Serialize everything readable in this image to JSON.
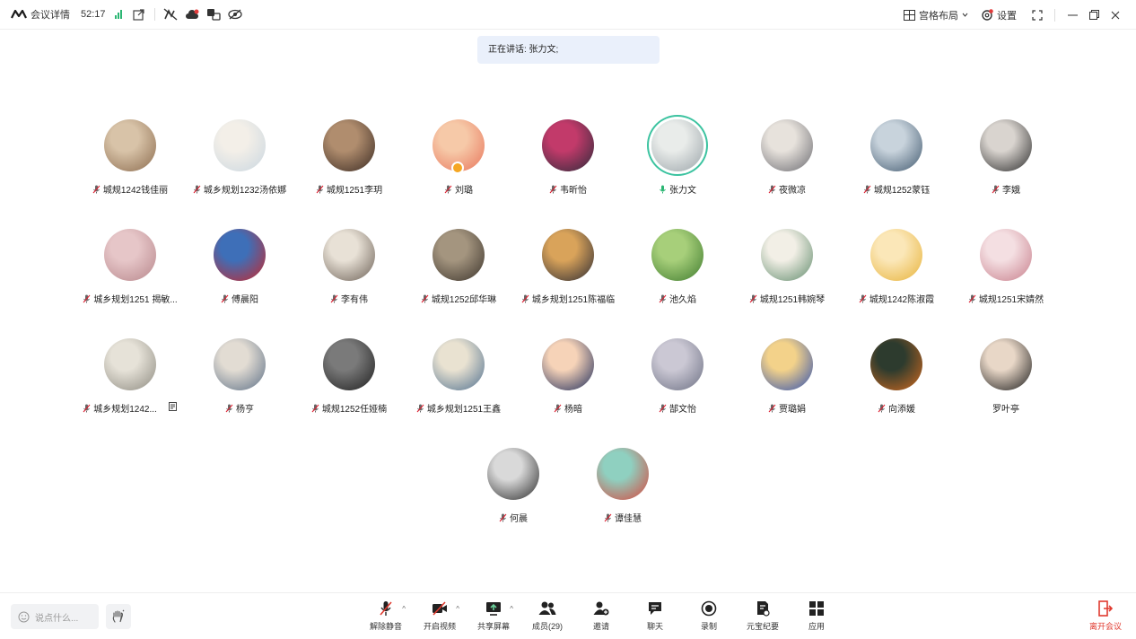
{
  "topbar": {
    "meeting_details": "会议详情",
    "timer": "52:17",
    "layout_label": "宫格布局",
    "settings_label": "设置"
  },
  "speaking": "正在讲话: 张力文;",
  "participants": [
    {
      "name": "城规1242钱佳丽",
      "c1": "#8b6b4e",
      "c2": "#d8c3a8",
      "muted": true
    },
    {
      "name": "城乡规划1232汤依娜",
      "c1": "#c9d6e0",
      "c2": "#f3efe8",
      "muted": true
    },
    {
      "name": "城规1251李玥",
      "c1": "#3a2a22",
      "c2": "#b08d6e",
      "muted": true
    },
    {
      "name": "刘璐",
      "c1": "#e8745a",
      "c2": "#f6c9a8",
      "muted": true,
      "badge": true
    },
    {
      "name": "韦昕怡",
      "c1": "#2b2b3a",
      "c2": "#c23a6a",
      "muted": true
    },
    {
      "name": "张力文",
      "c1": "#9aa3a8",
      "c2": "#e9ecea",
      "muted": false,
      "active": true
    },
    {
      "name": "夜微凉",
      "c1": "#6a6a70",
      "c2": "#e7e2dc",
      "muted": true
    },
    {
      "name": "城规1252蒙钰",
      "c1": "#40586e",
      "c2": "#c8d3dc",
      "muted": true
    },
    {
      "name": "李娥",
      "c1": "#2a2a2a",
      "c2": "#d9d4cf",
      "muted": true
    },
    {
      "name": "城乡规划1251 揭敏...",
      "c1": "#b7868b",
      "c2": "#e6c6c8",
      "muted": true
    },
    {
      "name": "傅晨阳",
      "c1": "#c8262a",
      "c2": "#3e6fb8",
      "muted": true
    },
    {
      "name": "李有伟",
      "c1": "#6b5f55",
      "c2": "#e8e1d6",
      "muted": true
    },
    {
      "name": "城规1252邱华琳",
      "c1": "#3b332b",
      "c2": "#a4957f",
      "muted": true
    },
    {
      "name": "城乡规划1251陈福临",
      "c1": "#2b2a33",
      "c2": "#d9a35a",
      "muted": true
    },
    {
      "name": "池久焰",
      "c1": "#3e7a2e",
      "c2": "#a7cf7a",
      "muted": true
    },
    {
      "name": "城规1251韩婉琴",
      "c1": "#5f8a6b",
      "c2": "#f2efe6",
      "muted": true
    },
    {
      "name": "城规1242陈淑霞",
      "c1": "#e7b238",
      "c2": "#fbe7b8",
      "muted": true
    },
    {
      "name": "城规1251宋婧然",
      "c1": "#c77d8a",
      "c2": "#f4dfe2",
      "muted": true
    },
    {
      "name": "城乡规划1242...",
      "c1": "#8d8a80",
      "c2": "#e6e2d8",
      "muted": true,
      "extra": true
    },
    {
      "name": "杨亨",
      "c1": "#5c6f86",
      "c2": "#e2dcd3",
      "muted": true
    },
    {
      "name": "城规1252任娅楠",
      "c1": "#1e1e1e",
      "c2": "#7a7a7a",
      "muted": true
    },
    {
      "name": "城乡规划1251王鑫",
      "c1": "#4e6f8f",
      "c2": "#e9e2d1",
      "muted": true
    },
    {
      "name": "杨暗",
      "c1": "#1c2a5a",
      "c2": "#f6d3b8",
      "muted": true
    },
    {
      "name": "郜文怡",
      "c1": "#6b6f82",
      "c2": "#cbc8d4",
      "muted": true
    },
    {
      "name": "贾璐娟",
      "c1": "#2e4fb0",
      "c2": "#f3d28a",
      "muted": true
    },
    {
      "name": "向添媛",
      "c1": "#d46a1f",
      "c2": "#2d3b2e",
      "muted": true
    },
    {
      "name": "罗叶亭",
      "c1": "#1a1a1a",
      "c2": "#e8d7c7",
      "muted": false
    },
    {
      "name": "何晨",
      "c1": "#2a2a2a",
      "c2": "#d9d9d9",
      "muted": true
    },
    {
      "name": "谭佳慧",
      "c1": "#d9443a",
      "c2": "#8fd0c0",
      "muted": true
    }
  ],
  "bottombar": {
    "chat_placeholder": "说点什么...",
    "tools": [
      {
        "id": "unmute",
        "label": "解除静音",
        "caret": true
      },
      {
        "id": "video",
        "label": "开启视频",
        "caret": true
      },
      {
        "id": "share",
        "label": "共享屏幕",
        "caret": true
      },
      {
        "id": "members",
        "label": "成员(29)",
        "caret": false
      },
      {
        "id": "invite",
        "label": "邀请",
        "caret": false
      },
      {
        "id": "chat",
        "label": "聊天",
        "caret": false
      },
      {
        "id": "record",
        "label": "录制",
        "caret": false
      },
      {
        "id": "minutes",
        "label": "元宝纪要",
        "caret": false
      },
      {
        "id": "apps",
        "label": "应用",
        "caret": false
      }
    ],
    "leave_label": "离开会议"
  }
}
